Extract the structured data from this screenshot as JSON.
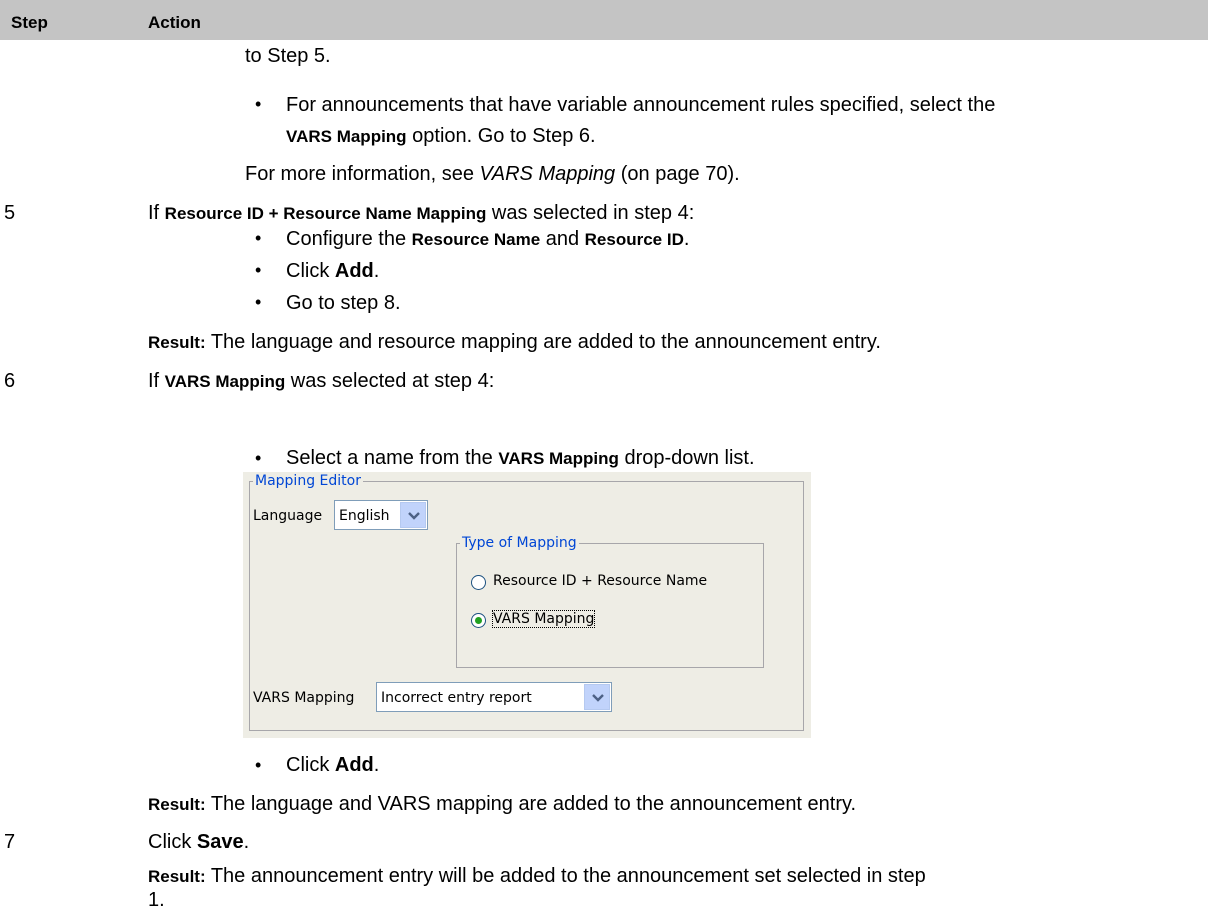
{
  "table_header": {
    "step": "Step",
    "action": "Action"
  },
  "step4_tail": {
    "line1": "to Step 5.",
    "bullet_a_line1": "For announcements that have variable announcement rules specified, select the",
    "bullet_a_line2_bold": "VARS Mapping",
    "bullet_a_line2_rest": " option. Go to Step 6.",
    "more_prefix": "For more information, see ",
    "more_link": "VARS Mapping",
    "more_suffix": " (on page 70)."
  },
  "step5": {
    "number": "5",
    "intro_prefix": "If ",
    "intro_bold": "Resource ID + Resource Name Mapping",
    "intro_suffix": " was selected in step 4:",
    "b1_prefix": "Configure the ",
    "b1_bold1": "Resource Name",
    "b1_mid": " and ",
    "b1_bold2": "Resource ID",
    "b1_suffix": ".",
    "b2_prefix": "Click ",
    "b2_bold": "Add",
    "b2_suffix": ".",
    "b3": "Go to step 8.",
    "result_label": "Result:",
    "result_text": " The language and resource mapping are added to the announcement entry."
  },
  "step6": {
    "number": "6",
    "intro_prefix": "If ",
    "intro_bold": "VARS Mapping",
    "intro_suffix": " was selected at step 4:",
    "b1_prefix": "Select a name from the ",
    "b1_bold": "VARS Mapping",
    "b1_suffix": " drop-down list.",
    "b2_prefix": "Click ",
    "b2_bold": "Add",
    "b2_suffix": ".",
    "result_label": "Result:",
    "result_text": " The language and VARS mapping are added to the announcement entry."
  },
  "step7": {
    "number": "7",
    "action_prefix": "Click ",
    "action_bold": "Save",
    "action_suffix": ".",
    "result_label": "Result:",
    "result_text_line1": " The announcement entry will be added to the announcement set selected in step",
    "result_text_line2": "1."
  },
  "mapping_editor": {
    "title": "Mapping Editor",
    "language_label": "Language",
    "language_value": "English",
    "type_group_title": "Type of Mapping",
    "radio1_label": "Resource ID + Resource Name",
    "radio1_selected": false,
    "radio2_label": "VARS Mapping",
    "radio2_selected": true,
    "vars_label": "VARS Mapping",
    "vars_value": "Incorrect entry report"
  },
  "colors": {
    "header_bg": "#c4c4c4",
    "panel_bg": "#eeede5",
    "legend_blue": "#0046d5"
  },
  "icons": [
    "chevron-down-icon",
    "bullet-icon"
  ]
}
